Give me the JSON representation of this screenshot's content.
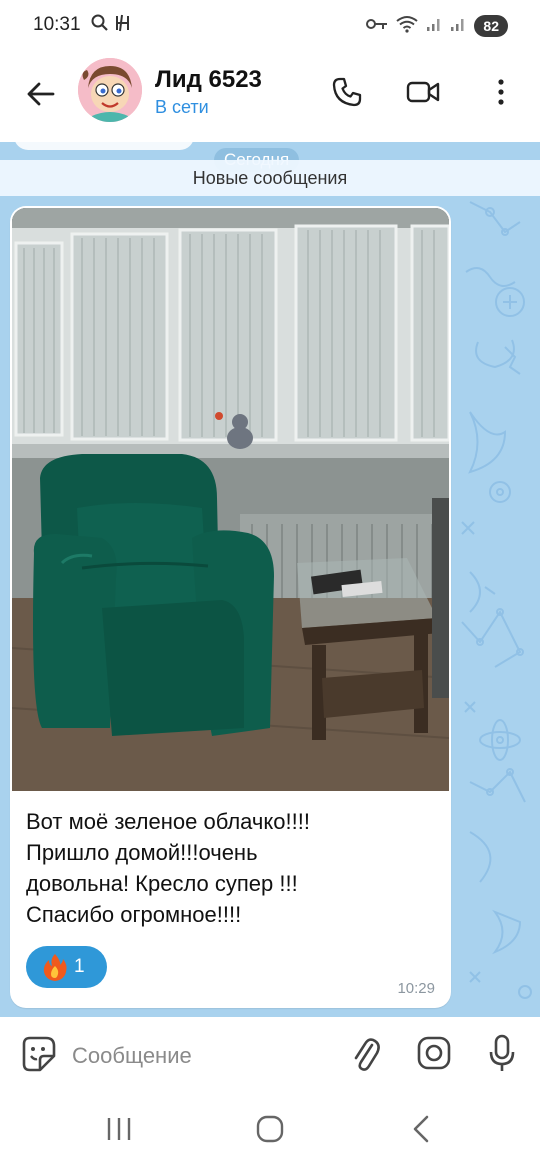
{
  "status_bar": {
    "time": "10:31",
    "battery": "82"
  },
  "header": {
    "name": "Лид 6523",
    "status": "В сети"
  },
  "chat": {
    "date_chip": "Сегодня",
    "new_messages": "Новые сообщения",
    "message": {
      "lines": [
        "Вот моё зеленое облачко!!!!",
        "Пришло домой!!!очень",
        "довольна! Кресло супер !!!",
        "Спасибо огромное!!!!"
      ],
      "reaction_emoji": "🔥",
      "reaction_count": "1",
      "time": "10:29"
    }
  },
  "input": {
    "placeholder": "Сообщение"
  },
  "colors": {
    "accent": "#2f8fe0",
    "chat_background": "#a9d2ee",
    "reaction": "#2f98d8"
  },
  "icons": [
    "search-icon",
    "signal-icon",
    "wifi-icon",
    "back-arrow-icon",
    "phone-icon",
    "video-icon",
    "more-vert-icon",
    "sticker-emoji-icon",
    "attach-icon",
    "camera-icon",
    "microphone-icon",
    "recents-icon",
    "home-icon",
    "nav-back-icon"
  ]
}
